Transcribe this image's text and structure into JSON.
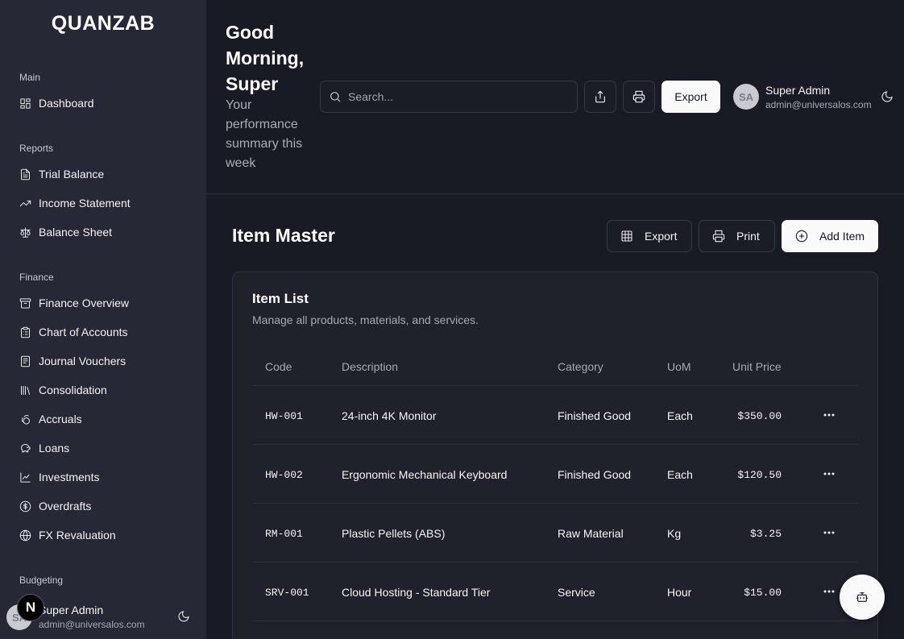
{
  "brand": "QUANZAB",
  "sidebar": {
    "sections": [
      {
        "label": "Main",
        "items": [
          {
            "label": "Dashboard",
            "icon": "layout-dashboard-icon"
          }
        ]
      },
      {
        "label": "Reports",
        "items": [
          {
            "label": "Trial Balance",
            "icon": "file-text-icon"
          },
          {
            "label": "Income Statement",
            "icon": "trending-up-icon"
          },
          {
            "label": "Balance Sheet",
            "icon": "scale-icon"
          }
        ]
      },
      {
        "label": "Finance",
        "items": [
          {
            "label": "Finance Overview",
            "icon": "archive-icon"
          },
          {
            "label": "Chart of Accounts",
            "icon": "clipboard-list-icon"
          },
          {
            "label": "Journal Vouchers",
            "icon": "notebook-icon"
          },
          {
            "label": "Consolidation",
            "icon": "library-icon"
          },
          {
            "label": "Accruals",
            "icon": "coins-icon"
          },
          {
            "label": "Loans",
            "icon": "piggy-bank-icon"
          },
          {
            "label": "Investments",
            "icon": "line-chart-icon"
          },
          {
            "label": "Overdrafts",
            "icon": "dollar-circle-icon"
          },
          {
            "label": "FX Revaluation",
            "icon": "globe-icon"
          }
        ]
      },
      {
        "label": "Budgeting",
        "items": []
      }
    ],
    "user": {
      "initials": "SA",
      "name": "Super Admin",
      "email": "admin@universalos.com"
    },
    "next_badge": "N"
  },
  "header": {
    "greeting": "Good Morning, Super",
    "subtitle": "Your performance summary this week",
    "search_placeholder": "Search...",
    "export_label": "Export",
    "user": {
      "initials": "SA",
      "name": "Super Admin",
      "email": "admin@universalos.com"
    }
  },
  "main": {
    "title": "Item Master",
    "actions": {
      "export": "Export",
      "print": "Print",
      "add": "Add Item"
    },
    "card": {
      "title": "Item List",
      "description": "Manage all products, materials, and services.",
      "columns": [
        "Code",
        "Description",
        "Category",
        "UoM",
        "Unit Price"
      ],
      "rows": [
        {
          "code": "HW-001",
          "description": "24-inch 4K Monitor",
          "category": "Finished Good",
          "uom": "Each",
          "price": "$350.00"
        },
        {
          "code": "HW-002",
          "description": "Ergonomic Mechanical Keyboard",
          "category": "Finished Good",
          "uom": "Each",
          "price": "$120.50"
        },
        {
          "code": "RM-001",
          "description": "Plastic Pellets (ABS)",
          "category": "Raw Material",
          "uom": "Kg",
          "price": "$3.25"
        },
        {
          "code": "SRV-001",
          "description": "Cloud Hosting - Standard Tier",
          "category": "Service",
          "uom": "Hour",
          "price": "$15.00"
        }
      ]
    }
  },
  "fab_icon": "bot-icon"
}
